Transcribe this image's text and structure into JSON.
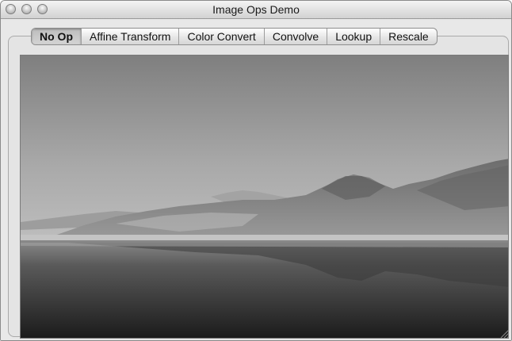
{
  "window": {
    "title": "Image Ops Demo"
  },
  "tabs": [
    {
      "label": "No Op",
      "selected": true
    },
    {
      "label": "Affine Transform",
      "selected": false
    },
    {
      "label": "Color Convert",
      "selected": false
    },
    {
      "label": "Convolve",
      "selected": false
    },
    {
      "label": "Lookup",
      "selected": false
    },
    {
      "label": "Rescale",
      "selected": false
    }
  ],
  "icons": {
    "close": "close-button-icon",
    "minimize": "minimize-button-icon",
    "zoom": "zoom-button-icon",
    "resize": "resize-grip-icon"
  }
}
